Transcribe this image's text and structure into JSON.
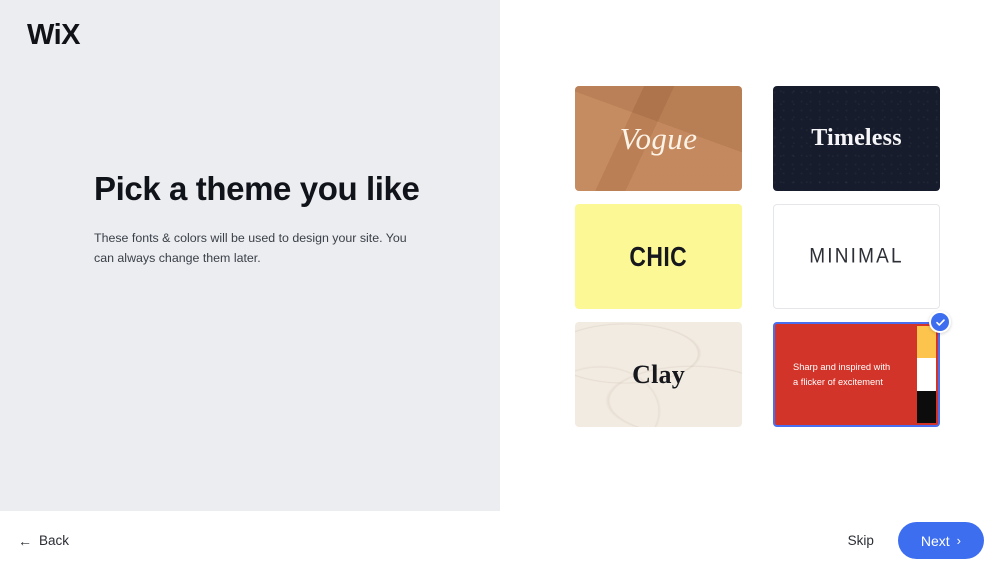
{
  "brand": {
    "logo_text": "WiX"
  },
  "left": {
    "headline": "Pick a theme you like",
    "subhead": "These fonts & colors will be used to design your site. You can always change them later."
  },
  "themes": [
    {
      "id": "vogue",
      "label": "Vogue",
      "bg": "#C08052",
      "text_color": "#FDF3E7",
      "selected": false
    },
    {
      "id": "timeless",
      "label": "Timeless",
      "bg": "#161C2B",
      "text_color": "#F6F6F8",
      "selected": false
    },
    {
      "id": "chic",
      "label": "CHIC",
      "bg": "#FCF896",
      "text_color": "#16181D",
      "selected": false
    },
    {
      "id": "minimal",
      "label": "MINIMAL",
      "bg": "#FFFFFF",
      "text_color": "#2C2F36",
      "selected": false
    },
    {
      "id": "clay",
      "label": "Clay",
      "bg": "#F2EBE1",
      "text_color": "#16181D",
      "selected": false
    },
    {
      "id": "sharp",
      "label": "Sharp and inspired with a flicker of excitement",
      "line1": "Sharp and inspired with",
      "line2": "a flicker of excitement",
      "bg": "#D23429",
      "text_color": "#FFFFFF",
      "selected": true,
      "swatches": [
        "#FCC44D",
        "#FFFFFF",
        "#0C0C0C"
      ],
      "selected_border": "#4A6EF0"
    }
  ],
  "footer": {
    "back_label": "Back",
    "back_arrow": "←",
    "skip_label": "Skip",
    "next_label": "Next",
    "next_chevron": "›",
    "accent": "#3D6EF0"
  }
}
